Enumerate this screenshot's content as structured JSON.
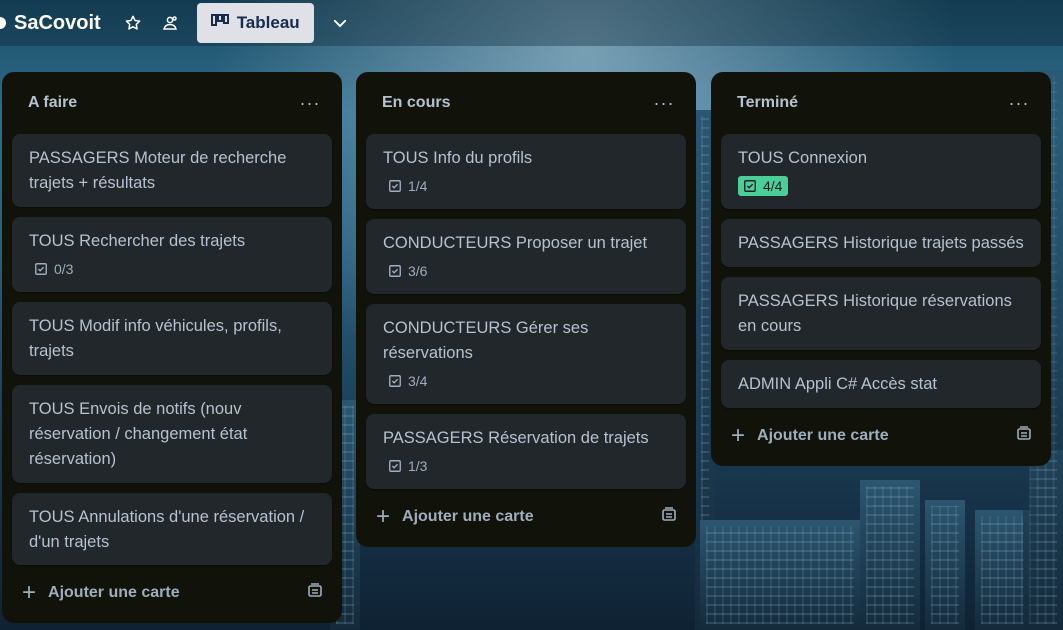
{
  "header": {
    "board_title": "SaCovoit",
    "view_label": "Tableau",
    "icons": [
      "star-icon",
      "team-visibility-icon",
      "board-view-icon",
      "chevron-down-icon"
    ]
  },
  "colors": {
    "list_bg": "#111209",
    "card_bg": "#22272b",
    "text": "#b6c2cf",
    "done_badge": "#4bce97"
  },
  "lists": [
    {
      "title": "A faire",
      "menu": "···",
      "cards": [
        {
          "title": "PASSAGERS Moteur de recherche trajets + résultats",
          "checklist": ""
        },
        {
          "title": "TOUS Rechercher des trajets",
          "checklist": "0/3"
        },
        {
          "title": "TOUS Modif info véhicules, profils, trajets",
          "checklist": ""
        },
        {
          "title": "TOUS Envois de notifs (nouv réservation / changement état réservation)",
          "checklist": ""
        },
        {
          "title": "TOUS Annulations d'une réservation / d'un trajets",
          "checklist": ""
        }
      ],
      "add_label": "Ajouter une carte"
    },
    {
      "title": "En cours",
      "menu": "···",
      "cards": [
        {
          "title": "TOUS Info du profils",
          "checklist": "1/4"
        },
        {
          "title": "CONDUCTEURS Proposer un trajet",
          "checklist": "3/6"
        },
        {
          "title": "CONDUCTEURS Gérer ses réservations",
          "checklist": "3/4"
        },
        {
          "title": "PASSAGERS Réservation de trajets",
          "checklist": "1/3"
        }
      ],
      "add_label": "Ajouter une carte"
    },
    {
      "title": "Terminé",
      "menu": "···",
      "cards": [
        {
          "title": "TOUS Connexion",
          "checklist": "4/4",
          "complete": true
        },
        {
          "title": "PASSAGERS Historique trajets passés",
          "checklist": ""
        },
        {
          "title": "PASSAGERS Historique réservations en cours",
          "checklist": ""
        },
        {
          "title": "ADMIN Appli C# Accès stat",
          "checklist": ""
        }
      ],
      "add_label": "Ajouter une carte"
    }
  ]
}
